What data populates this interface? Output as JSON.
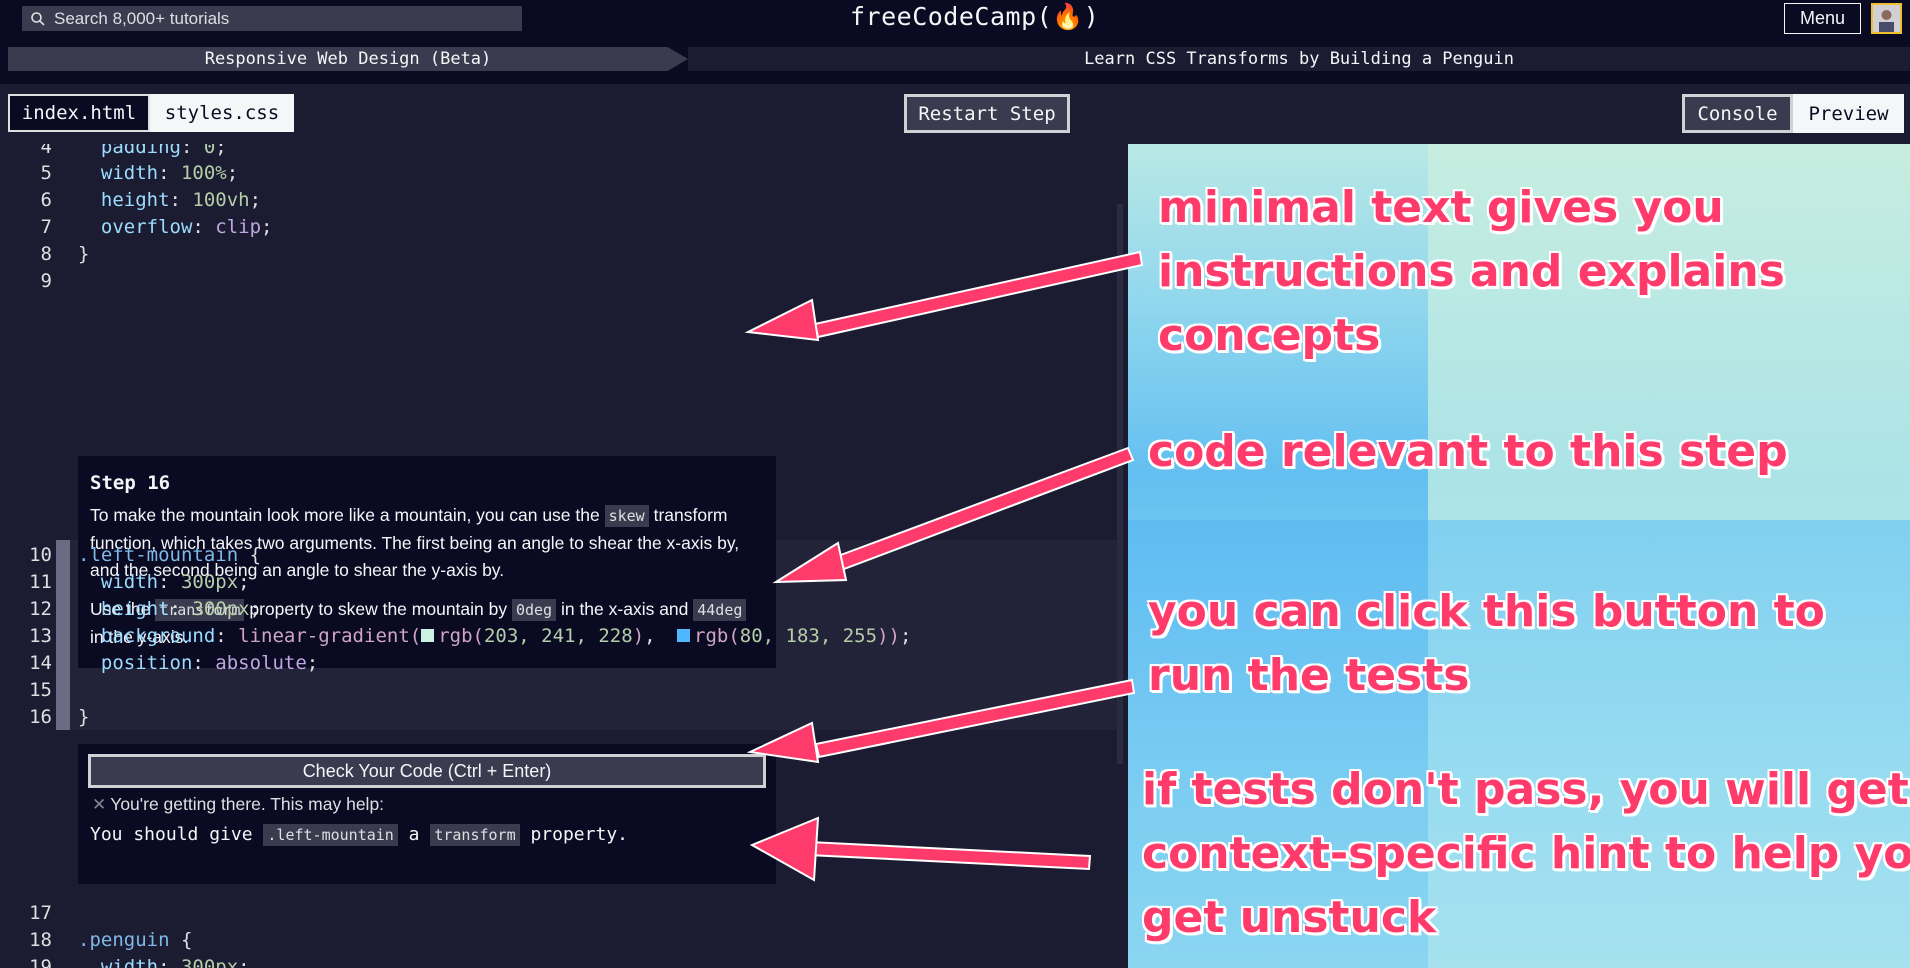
{
  "nav": {
    "search_placeholder": "Search 8,000+ tutorials",
    "logo": "freeCodeCamp(🔥)",
    "menu_label": "Menu"
  },
  "breadcrumb": {
    "course": "Responsive Web Design (Beta)",
    "project": "Learn CSS Transforms by Building a Penguin"
  },
  "toolbar": {
    "tabs": [
      {
        "label": "index.html",
        "active": false
      },
      {
        "label": "styles.css",
        "active": true
      }
    ],
    "restart_label": "Restart Step",
    "console_label": "Console",
    "preview_label": "Preview"
  },
  "editor": {
    "lines_top": [
      {
        "n": "4",
        "text": "  padding: 0;"
      },
      {
        "n": "5",
        "text": "  width: 100%;"
      },
      {
        "n": "6",
        "text": "  height: 100vh;"
      },
      {
        "n": "7",
        "text": "  overflow: clip;"
      },
      {
        "n": "8",
        "text": "}"
      },
      {
        "n": "9",
        "text": ""
      }
    ],
    "lines_mid": [
      {
        "n": "10",
        "text": ".left-mountain {"
      },
      {
        "n": "11",
        "text": "  width: 300px;"
      },
      {
        "n": "12",
        "text": "  height: 300px;"
      },
      {
        "n": "13",
        "text": "  background: linear-gradient(▢rgb(203, 241, 228), ▢rgb(80, 183, 255));"
      },
      {
        "n": "14",
        "text": "  position: absolute;"
      },
      {
        "n": "15",
        "text": ""
      },
      {
        "n": "16",
        "text": "}"
      }
    ],
    "lines_bottom": [
      {
        "n": "17",
        "text": ""
      },
      {
        "n": "18",
        "text": ".penguin {"
      },
      {
        "n": "19",
        "text": "  width: 300px;"
      }
    ],
    "swatch_colors": [
      "#cbf1e4",
      "#50b7ff"
    ]
  },
  "step": {
    "title": "Step 16",
    "p1_a": "To make the mountain look more like a mountain, you can use the ",
    "p1_code": "skew",
    "p1_b": " transform function, which takes two arguments. The first being an angle to shear the x-axis by, and the second being an angle to shear the y-axis by.",
    "p2_a": "Use the ",
    "p2_code1": "transform",
    "p2_b": " property to skew the mountain by ",
    "p2_code2": "0deg",
    "p2_c": " in the x-axis and ",
    "p2_code3": "44deg",
    "p2_d": " in the y-axis."
  },
  "check": {
    "button_label": "Check Your Code (Ctrl + Enter)",
    "hint_intro": "You're getting there. This may help:",
    "hint_a": "You should give ",
    "hint_code1": ".left-mountain",
    "hint_b": " a ",
    "hint_code2": "transform",
    "hint_c": " property."
  },
  "annotations": {
    "a1": "minimal text gives you\ninstructions and explains\nconcepts",
    "a2": "code relevant to this step",
    "a3": "you can click this button to\nrun the tests",
    "a4": "if tests don't pass, you will get a\ncontext-specific hint to help you\nget unstuck"
  },
  "colors": {
    "annotation": "#ff3b6b",
    "nav_bg": "#0a0a23",
    "editor_bg": "#1b1b32"
  }
}
